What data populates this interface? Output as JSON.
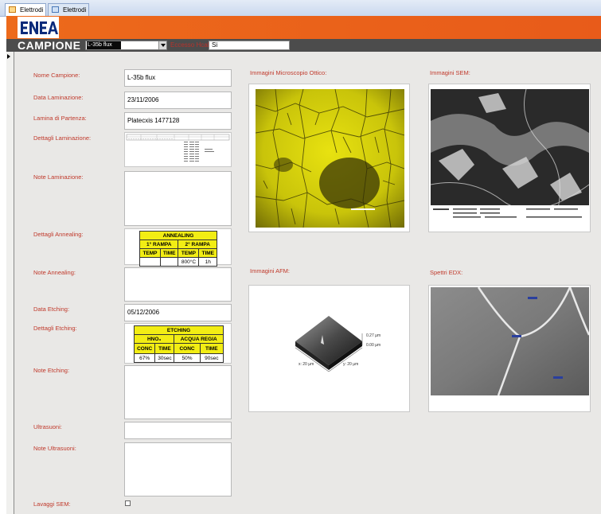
{
  "tabs": [
    {
      "label": "Elettrodi",
      "active": true
    },
    {
      "label": "Elettrodi",
      "active": false
    }
  ],
  "header": {
    "logo_text": "ENEA",
    "campione_label": "CAMPIONE",
    "campione_value": "L-35b flux",
    "eccesso_label": "Eccesso Hcal:",
    "eccesso_value": "Si"
  },
  "form": {
    "nome_campione": {
      "label": "Nome Campione:",
      "value": "L-35b flux"
    },
    "data_laminazione": {
      "label": "Data Laminazione:",
      "value": "23/11/2006"
    },
    "lamina_partenza": {
      "label": "Lamina di Partenza:",
      "value": "Platecxis 1477128"
    },
    "dettagli_laminazione": {
      "label": "Dettagli Laminazione:"
    },
    "note_laminazione": {
      "label": "Note Laminazione:",
      "value": ""
    },
    "dettagli_annealing": {
      "label": "Dettagli Annealing:"
    },
    "note_annealing": {
      "label": "Note Annealing:",
      "value": ""
    },
    "data_etching": {
      "label": "Data Etching:",
      "value": "05/12/2006"
    },
    "dettagli_etching": {
      "label": "Dettagli Etching:"
    },
    "note_etching": {
      "label": "Note Etching:",
      "value": ""
    },
    "ultrasuoni": {
      "label": "Ultrasuoni:",
      "value": ""
    },
    "note_ultrasuoni": {
      "label": "Note Ultrasuoni:",
      "value": ""
    },
    "lavaggi_sem": {
      "label": "Lavaggi SEM:",
      "checked": false
    }
  },
  "annealing_table": {
    "title": "ANNEALING",
    "rampa1": "1° RAMPA",
    "rampa2": "2° RAMPA",
    "cols": [
      "TEMP",
      "TIME",
      "TEMP",
      "TIME"
    ],
    "values": [
      "",
      "",
      "800°C",
      "1h"
    ]
  },
  "etching_table": {
    "title": "ETCHING",
    "hno3": "HNO₃",
    "acqua": "ACQUA REGIA",
    "cols": [
      "CONC",
      "TIME",
      "CONC",
      "TIME"
    ],
    "values": [
      "67%",
      "30sec",
      "50%",
      "90sec"
    ]
  },
  "images": {
    "ottico_label": "Immagini Microscopio Ottico:",
    "sem_label": "Immagini SEM:",
    "afm_label": "Immagini AFM:",
    "eds_label": "Spettri EDX:",
    "afm_z1": "0.27 µm",
    "afm_z2": "0.00 µm",
    "afm_x": "x: 20 µm",
    "afm_y": "y: 20 µm"
  },
  "colors": {
    "banner": "#e8601a",
    "campbar": "#4c4c4c",
    "label": "#c0392b",
    "table_yellow": "#f2ed14"
  }
}
